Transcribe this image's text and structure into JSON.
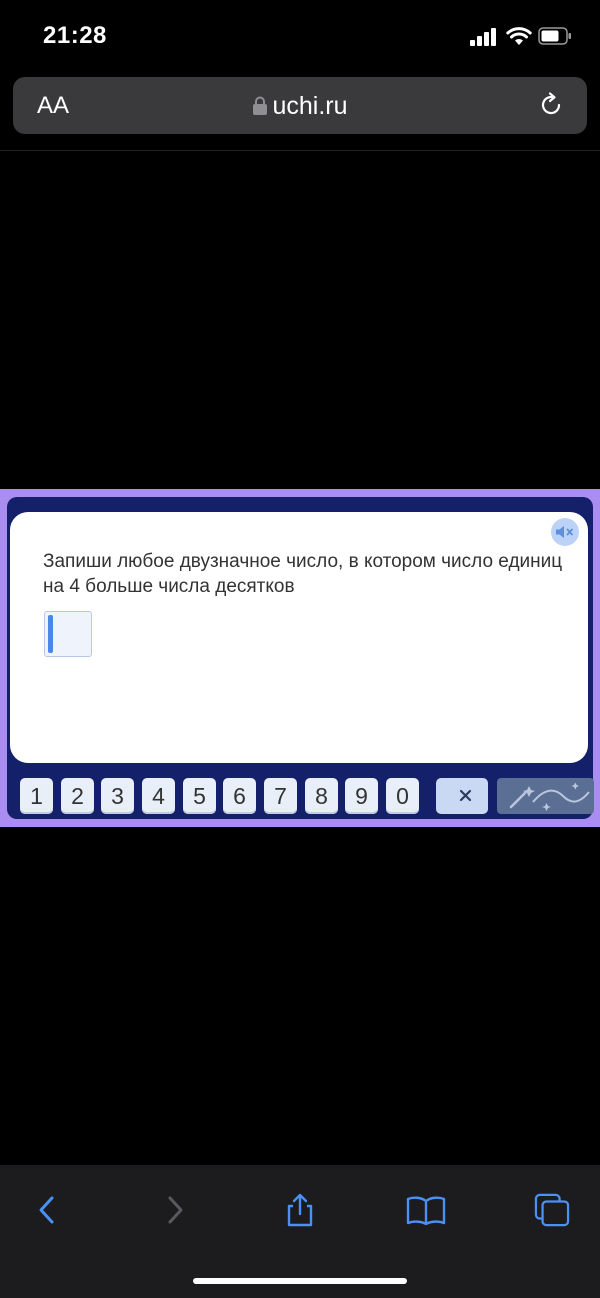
{
  "status": {
    "time": "21:28"
  },
  "browser": {
    "text_size_label": "AA",
    "url": "uchi.ru"
  },
  "task": {
    "question": "Запиши любое двузначное число, в котором число единиц на 4 больше числа десятков",
    "answer_value": ""
  },
  "keypad": {
    "keys": [
      "1",
      "2",
      "3",
      "4",
      "5",
      "6",
      "7",
      "8",
      "9",
      "0"
    ]
  },
  "colors": {
    "frame_border": "#a98df0",
    "frame_inner": "#14206a",
    "key_bg": "#e9eff8",
    "caret": "#4b86ea"
  },
  "icons": {
    "sound": "speaker-muted-icon",
    "delete": "backspace-icon",
    "magic": "magic-wand-icon",
    "toolbar": [
      "back-icon",
      "forward-icon",
      "share-icon",
      "bookmarks-icon",
      "tabs-icon"
    ]
  }
}
